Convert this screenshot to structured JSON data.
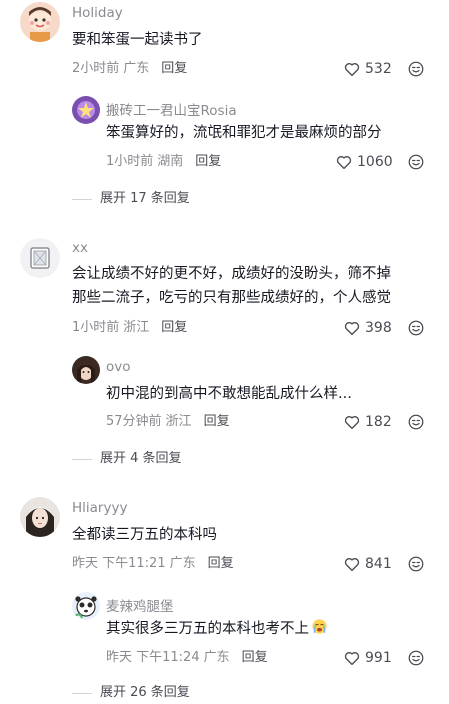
{
  "comments": [
    {
      "user": "Holiday",
      "text": "要和笨蛋一起读书了",
      "time": "2小时前",
      "location": "广东",
      "reply": "回复",
      "likes": "532",
      "replies": [
        {
          "user": "搬砖工一君山宝Rosia",
          "text": "笨蛋算好的，流氓和罪犯才是最麻烦的部分",
          "time": "1小时前",
          "location": "湖南",
          "reply": "回复",
          "likes": "1060"
        }
      ],
      "expand": "展开 17 条回复"
    },
    {
      "user": "xx",
      "text_lines": [
        "会让成绩不好的更不好，成绩好的没盼头，筛不掉",
        "那些二流子，吃亏的只有那些成绩好的，个人感觉"
      ],
      "time": "1小时前",
      "location": "浙江",
      "reply": "回复",
      "likes": "398",
      "replies": [
        {
          "user": "ovo",
          "text": "初中混的到高中不敢想能乱成什么样...",
          "time": "57分钟前",
          "location": "浙江",
          "reply": "回复",
          "likes": "182"
        }
      ],
      "expand": "展开 4 条回复"
    },
    {
      "user": "Hliaryyy",
      "text": "全都读三万五的本科吗",
      "time": "昨天 下午11:21",
      "location": "广东",
      "reply": "回复",
      "likes": "841",
      "replies": [
        {
          "user": "麦辣鸡腿堡",
          "text": "其实很多三万五的本科也考不上",
          "time": "昨天 下午11:24",
          "location": "广东",
          "reply": "回复",
          "likes": "991"
        }
      ],
      "expand": "展开 26 条回复"
    }
  ],
  "icons": {
    "like": "heart-outline-icon",
    "emoji": "emoji-face-icon"
  },
  "colors": {
    "username": "#8a8b91",
    "text": "#161823",
    "meta": "#8a8b91",
    "action": "#4b4c55"
  }
}
